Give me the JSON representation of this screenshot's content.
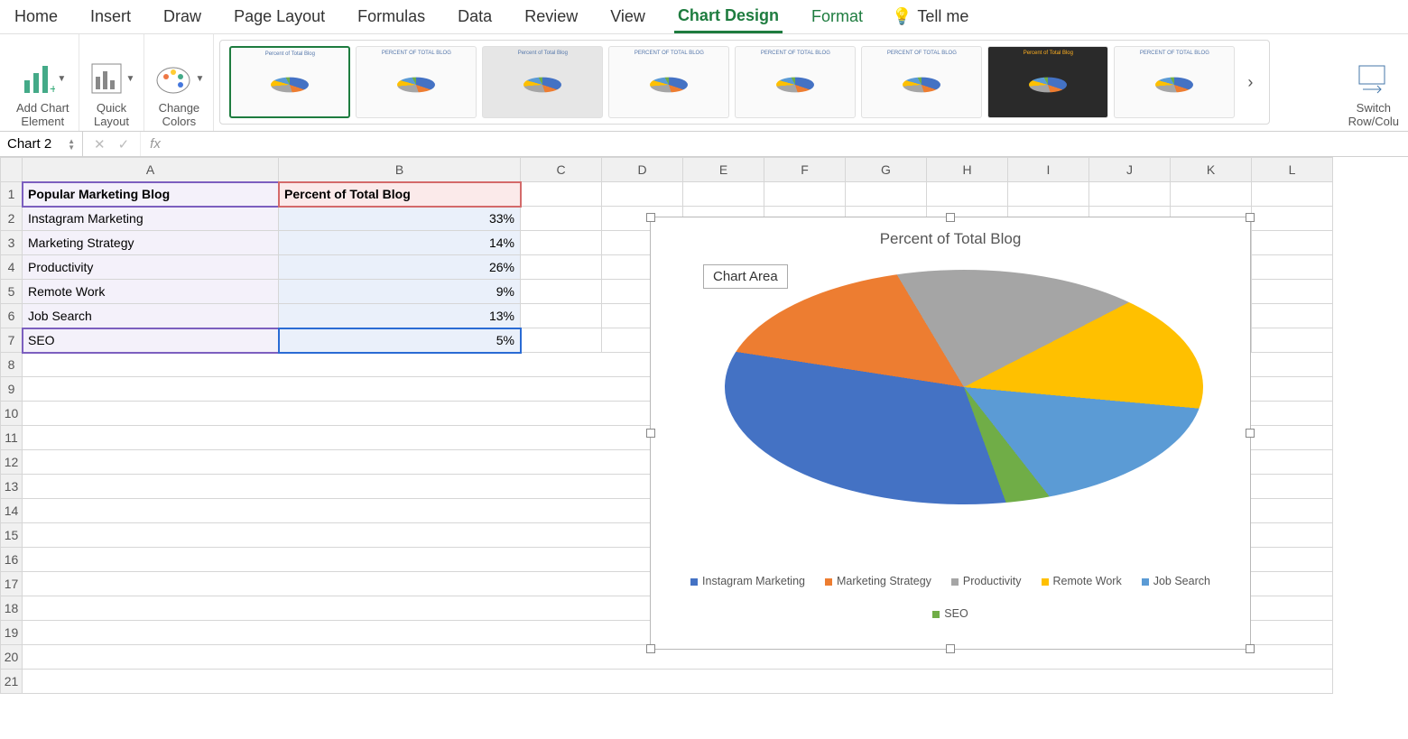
{
  "tabs": {
    "items": [
      "Home",
      "Insert",
      "Draw",
      "Page Layout",
      "Formulas",
      "Data",
      "Review",
      "View",
      "Chart Design",
      "Format"
    ],
    "active": "Chart Design",
    "tellme_label": "Tell me"
  },
  "ribbon": {
    "add_element": "Add Chart\nElement",
    "quick_layout": "Quick\nLayout",
    "change_colors": "Change\nColors",
    "gallery_title": "Percent of Total Blog",
    "gallery_title_caps": "PERCENT OF TOTAL BLOG",
    "switch": "Switch\nRow/Colu"
  },
  "fx": {
    "namebox": "Chart 2",
    "fx_label": "fx"
  },
  "columns": [
    "A",
    "B",
    "C",
    "D",
    "E",
    "F",
    "G",
    "H",
    "I",
    "J",
    "K",
    "L"
  ],
  "table": {
    "header": {
      "a": "Popular Marketing Blog",
      "b": "Percent of Total Blog"
    },
    "rows": [
      {
        "a": "Instagram Marketing",
        "b": "33%"
      },
      {
        "a": "Marketing Strategy",
        "b": "14%"
      },
      {
        "a": "Productivity",
        "b": "26%"
      },
      {
        "a": "Remote Work",
        "b": "9%"
      },
      {
        "a": "Job Search",
        "b": "13%"
      },
      {
        "a": "SEO",
        "b": "5%"
      }
    ]
  },
  "chart": {
    "title": "Percent of Total Blog",
    "tooltip": "Chart Area",
    "legend": [
      "Instagram Marketing",
      "Marketing Strategy",
      "Productivity",
      "Remote Work",
      "Job Search",
      "SEO"
    ],
    "colors": [
      "#4472C4",
      "#ED7D31",
      "#A5A5A5",
      "#FFC000",
      "#5B9BD5",
      "#70AD47"
    ]
  },
  "chart_data": {
    "type": "pie",
    "title": "Percent of Total Blog",
    "categories": [
      "Instagram Marketing",
      "Marketing Strategy",
      "Productivity",
      "Remote Work",
      "Job Search",
      "SEO"
    ],
    "values": [
      33,
      14,
      26,
      9,
      13,
      5
    ],
    "colors": [
      "#4472C4",
      "#ED7D31",
      "#A5A5A5",
      "#FFC000",
      "#5B9BD5",
      "#70AD47"
    ],
    "legend_position": "bottom",
    "3d": true
  }
}
